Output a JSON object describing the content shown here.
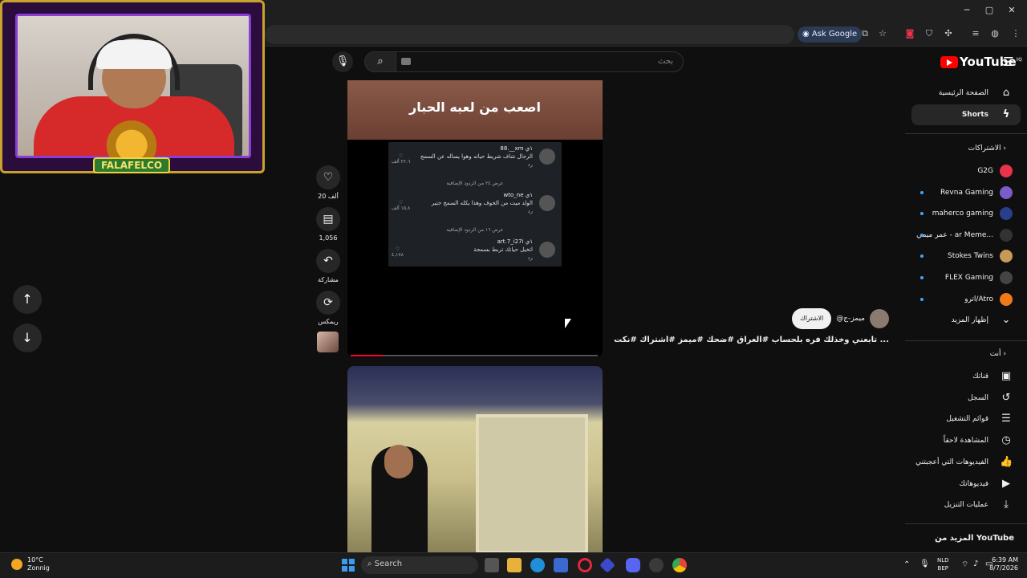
{
  "browser": {
    "ask_google": "Ask Google",
    "window_controls": {
      "minimize": "─",
      "maximize": "▢",
      "close": "✕"
    }
  },
  "webcam": {
    "logo_text": "FALAFELCO"
  },
  "youtube": {
    "logo_text": "YouTube",
    "region_code": "IQ",
    "search_placeholder": "بحث",
    "sidebar": {
      "home": "الصفحة الرئيسية",
      "shorts": "Shorts",
      "subscriptions_title": "الاشتراكات",
      "subscriptions": [
        {
          "name": "G2G",
          "color": "#e8334a",
          "new": false
        },
        {
          "name": "Revna Gaming",
          "color": "#7a5cc8",
          "new": true
        },
        {
          "name": "maherco gaming",
          "color": "#2a3f8a",
          "new": true
        },
        {
          "name": "عمر ميمي - ar Meme...",
          "color": "#333333",
          "new": true
        },
        {
          "name": "Stokes Twins",
          "color": "#c79a56",
          "new": true
        },
        {
          "name": "FLEX Gaming",
          "color": "#444444",
          "new": true
        },
        {
          "name": "أترو/Atro",
          "color": "#f07a1a",
          "new": true
        }
      ],
      "show_more": "إظهار المزيد",
      "you_title": "أنت",
      "you_items": [
        {
          "label": "قناتك",
          "icon": "account-box-icon"
        },
        {
          "label": "السجل",
          "icon": "history-icon"
        },
        {
          "label": "قوائم التشغيل",
          "icon": "playlist-icon"
        },
        {
          "label": "المشاهدة لاحقاً",
          "icon": "clock-icon"
        },
        {
          "label": "الفيديوهات التي أعجبتني",
          "icon": "thumb-up-icon"
        },
        {
          "label": "فيديوهاتك",
          "icon": "video-icon"
        },
        {
          "label": "عمليات التنزيل",
          "icon": "download-icon"
        }
      ],
      "more_from": "المزيد من YouTube"
    },
    "short": {
      "overlay_text": "اصعب من لعبه الحبار",
      "likes": "20 ألف",
      "comments_count": "1,056",
      "share": "مشاركة",
      "remix": "ريمكس",
      "channel": "@ميمز-ج",
      "subscribe": "الاشتراك",
      "title": "تابعني وخذلك فره بلحساب #العراق #ضحك #ميمز #اشتراك #نكت ...",
      "progress": 0.13
    },
    "comments": [
      {
        "user": "88.__xm",
        "age": "١ي",
        "text": "الرجال شاف شريط حياته وهوا يساله عن السمج",
        "likes": "٢٢.٦ ألف",
        "reply": "رد"
      },
      {
        "more": "عرض ٢٤ من الردود الإضافية"
      },
      {
        "user": "wto_ne",
        "age": "١ي",
        "text": "الولد ميت من الخوف وهذا يكله السمج جتير",
        "likes": "١٥.٨ ألف",
        "reply": "رد"
      },
      {
        "more": "عرض ١٦ من الردود الإضافية"
      },
      {
        "user": "art.7_i27i",
        "age": "١ي",
        "text": "اتخيل حياتك تربط بسمجة",
        "likes": "٤,١٧٨",
        "reply": "رد"
      }
    ]
  },
  "taskbar": {
    "weather_temp": "10°C",
    "weather_desc": "Zonnig",
    "search": "Search",
    "lang_top": "NLD",
    "lang_bottom": "BEP",
    "time": "6:39 AM",
    "date": "8/7/2026"
  }
}
